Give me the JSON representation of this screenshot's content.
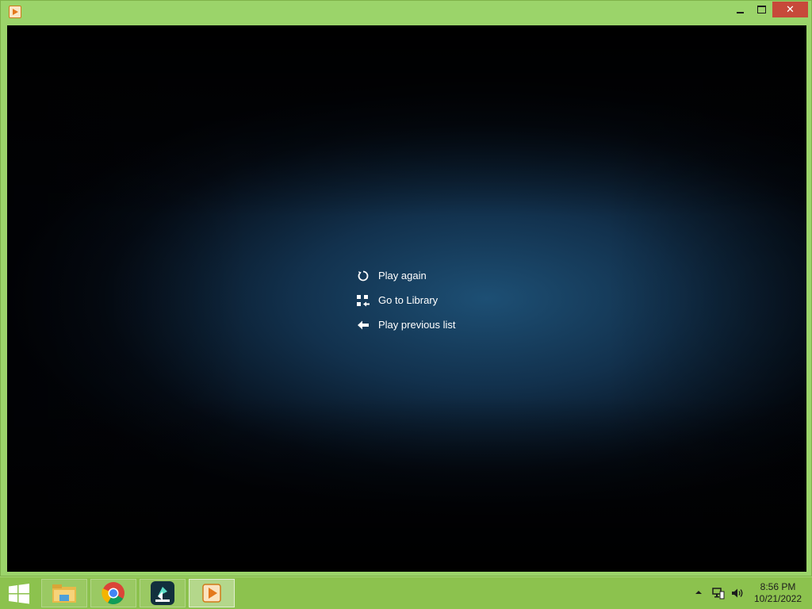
{
  "window": {
    "icon": "media-player-icon",
    "controls": {
      "minimize": "minimize-icon",
      "maximize": "maximize-icon",
      "close": "close-icon",
      "close_glyph": "✕"
    }
  },
  "player_menu": {
    "items": [
      {
        "label": "Play again",
        "icon": "replay-icon"
      },
      {
        "label": "Go to Library",
        "icon": "library-icon"
      },
      {
        "label": "Play previous list",
        "icon": "back-arrow-icon"
      }
    ]
  },
  "taskbar": {
    "start_icon": "windows-logo-icon",
    "apps": [
      {
        "name": "File Explorer",
        "icon": "file-explorer-icon"
      },
      {
        "name": "Google Chrome",
        "icon": "chrome-icon"
      },
      {
        "name": "Filmora",
        "icon": "filmora-icon"
      },
      {
        "name": "Media Player",
        "icon": "media-player-icon",
        "active": true
      }
    ],
    "tray": {
      "show_hidden_icon": "chevron-up-icon",
      "network_icon": "network-icon",
      "volume_icon": "speaker-icon"
    },
    "clock": {
      "time": "8:56 PM",
      "date": "10/21/2022"
    }
  },
  "colors": {
    "frame": "#9bd46a",
    "taskbar": "#8cc24e",
    "close_button": "#c7493a",
    "menu_text": "#ffffff"
  }
}
